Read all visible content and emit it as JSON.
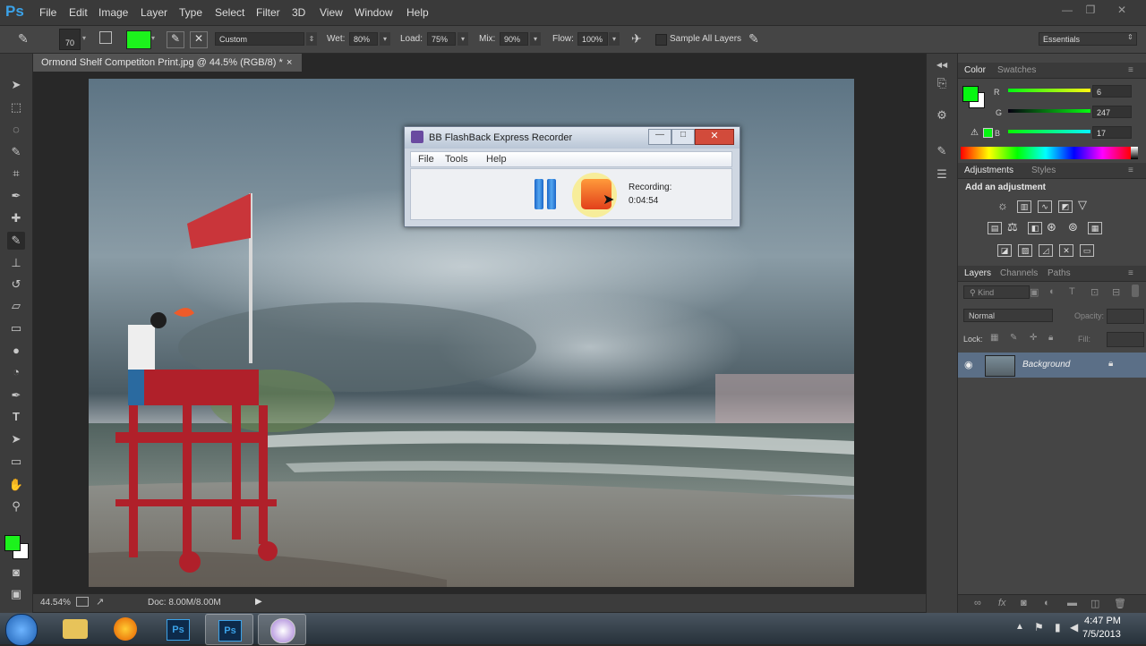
{
  "app": {
    "logo": "Ps",
    "menus": [
      "File",
      "Edit",
      "Image",
      "Layer",
      "Type",
      "Select",
      "Filter",
      "3D",
      "View",
      "Window",
      "Help"
    ],
    "window_controls": [
      "—",
      "❐",
      "✕"
    ]
  },
  "options_bar": {
    "brush_size": "70",
    "preset": "Custom",
    "wet_label": "Wet:",
    "wet_value": "80%",
    "load_label": "Load:",
    "load_value": "75%",
    "mix_label": "Mix:",
    "mix_value": "90%",
    "flow_label": "Flow:",
    "flow_value": "100%",
    "sample_all_label": "Sample All Layers",
    "workspace": "Essentials",
    "foreground_color": "#1cf21c"
  },
  "document": {
    "tab_title": "Ormond Shelf Competiton Print.jpg @ 44.5% (RGB/8) *",
    "tab_close": "×",
    "zoom": "44.54%",
    "doc_info": "Doc: 8.00M/8.00M"
  },
  "color_panel": {
    "tabs": [
      "Color",
      "Swatches"
    ],
    "r_label": "R",
    "r_value": "6",
    "g_label": "G",
    "g_value": "247",
    "b_label": "B",
    "b_value": "17",
    "swatch": "#06f711"
  },
  "adjustments_panel": {
    "tabs": [
      "Adjustments",
      "Styles"
    ],
    "heading": "Add an adjustment"
  },
  "layers_panel": {
    "tabs": [
      "Layers",
      "Channels",
      "Paths"
    ],
    "filter": "Kind",
    "blend_mode": "Normal",
    "opacity_label": "Opacity:",
    "lock_label": "Lock:",
    "fill_label": "Fill:",
    "layers": [
      {
        "name": "Background",
        "visible": true,
        "locked": true
      }
    ]
  },
  "recorder": {
    "title": "BB FlashBack Express Recorder",
    "menus": [
      "File",
      "Tools",
      "Help"
    ],
    "status_label": "Recording:",
    "time": "0:04:54"
  },
  "taskbar": {
    "time": "4:47 PM",
    "date": "7/5/2013"
  }
}
